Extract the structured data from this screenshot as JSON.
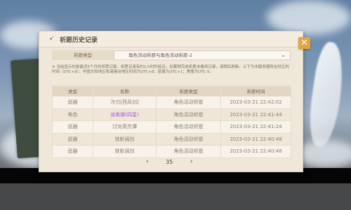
{
  "dialog": {
    "title": "祈愿历史记录",
    "close_symbol": "✕"
  },
  "filter": {
    "label": "祈愿类型",
    "selected": "角色活动祈愿与角色活动祈愿-2"
  },
  "note": "※ 当前显示的是最近6个月的祈愿记录，祈愿记录有约1小时的延迟。如果刚完成祈愿未看到记录，请稍后刷新。以下为本服务器所在时区的时间（UTC+8）：中国大陆地区和港澳台地区时间为UTC+8；欧服为UTC+1；美服为UTC-5。",
  "table": {
    "headers": [
      "类型",
      "名称",
      "祈愿类型",
      "祈愿时间"
    ],
    "rows": [
      {
        "type": "武器",
        "name": "冷刃[西风剑]",
        "wish": "角色活动祈愿",
        "time": "2023-03-21 22:42:02",
        "highlight": false
      },
      {
        "type": "角色",
        "name": "迪奥娜(四星)",
        "wish": "角色活动祈愿",
        "time": "2023-03-21 22:41:44",
        "highlight": true
      },
      {
        "type": "武器",
        "name": "讨龙英杰谭",
        "wish": "角色活动祈愿",
        "time": "2023-03-21 22:41:24",
        "highlight": false
      },
      {
        "type": "武器",
        "name": "铁影阔剑",
        "wish": "角色活动祈愿",
        "time": "2023-03-21 22:40:48",
        "highlight": false
      },
      {
        "type": "武器",
        "name": "铁影阔剑",
        "wish": "角色活动祈愿",
        "time": "2023-03-21 22:40:48",
        "highlight": false
      }
    ]
  },
  "pager": {
    "prev": "‹",
    "page": "35",
    "next": "›"
  }
}
